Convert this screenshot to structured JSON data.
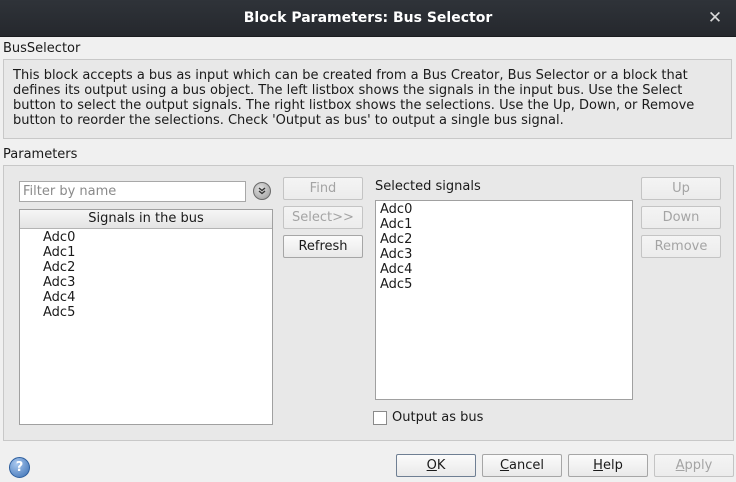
{
  "window": {
    "title": "Block Parameters: Bus Selector",
    "close_glyph": "✕"
  },
  "block": {
    "name": "BusSelector",
    "description": "This block accepts a bus as input which can be created from a Bus Creator, Bus Selector or a block that defines its output using a bus object. The left listbox shows the signals in the input bus. Use the Select button to select the output signals. The right listbox shows the selections. Use the Up, Down, or Remove button to reorder the selections. Check 'Output as bus' to output a single bus signal."
  },
  "parameters": {
    "label": "Parameters",
    "filter": {
      "placeholder": "Filter by name",
      "value": "",
      "options_icon": "chevron-down-circle-icon"
    },
    "signals_list": {
      "header": "Signals in the bus",
      "items": [
        "Adc0",
        "Adc1",
        "Adc2",
        "Adc3",
        "Adc4",
        "Adc5"
      ]
    },
    "middle_buttons": {
      "find": "Find",
      "select": "Select>>",
      "refresh": "Refresh"
    },
    "selected_list": {
      "label": "Selected signals",
      "items": [
        "Adc0",
        "Adc1",
        "Adc2",
        "Adc3",
        "Adc4",
        "Adc5"
      ]
    },
    "order_buttons": {
      "up": "Up",
      "down": "Down",
      "remove": "Remove"
    },
    "output_as_bus": {
      "label": "Output as bus",
      "checked": false
    }
  },
  "footer": {
    "help_icon": "question-icon",
    "help_glyph": "?",
    "ok": {
      "mnemonic": "O",
      "rest": "K"
    },
    "cancel": {
      "mnemonic": "C",
      "rest": "ancel"
    },
    "help": {
      "mnemonic": "H",
      "rest": "elp"
    },
    "apply": {
      "mnemonic": "A",
      "rest": "pply"
    }
  }
}
